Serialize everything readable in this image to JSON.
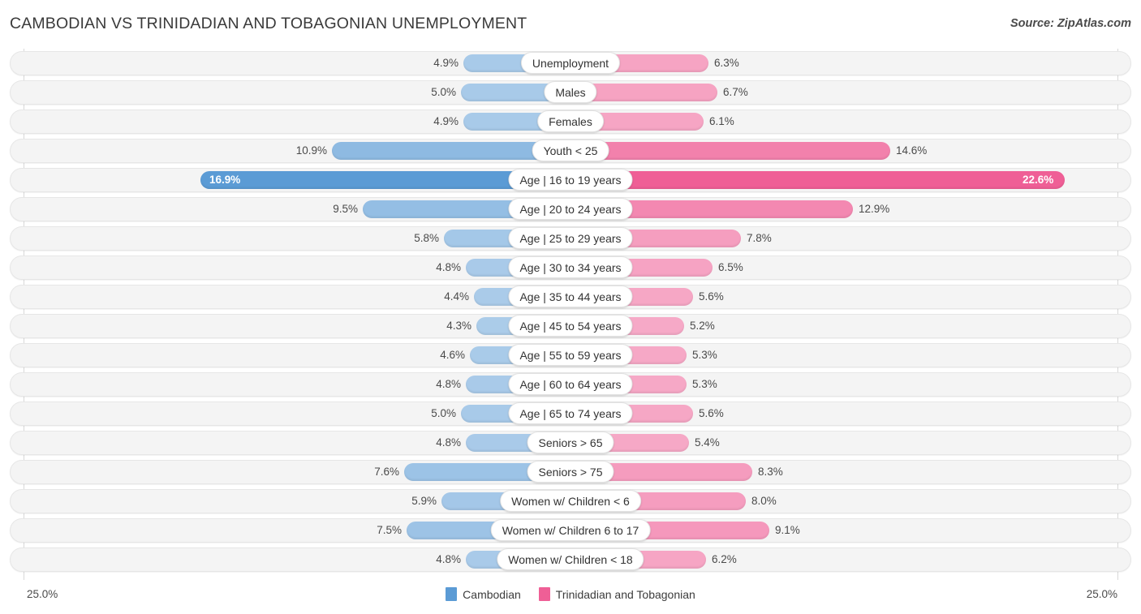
{
  "header": {
    "title": "CAMBODIAN VS TRINIDADIAN AND TOBAGONIAN UNEMPLOYMENT",
    "source": "Source: ZipAtlas.com"
  },
  "axis": {
    "left_label": "25.0%",
    "right_label": "25.0%",
    "max": 25.0
  },
  "legend": [
    {
      "label": "Cambodian",
      "color": "#5b9bd5"
    },
    {
      "label": "Trinidadian and Tobagonian",
      "color": "#ef5f96"
    }
  ],
  "colors": {
    "left_base": "#5b9bd5",
    "right_base": "#ef5f96",
    "left_light": "#9cc3ea",
    "right_light": "#f79ebc",
    "track": "#f4f4f4",
    "gridline": "#d8d8d8"
  },
  "chart_data": {
    "type": "bar",
    "title": "CAMBODIAN VS TRINIDADIAN AND TOBAGONIAN UNEMPLOYMENT",
    "subtitle": "",
    "orientation": "horizontal-diverging",
    "xlabel": "",
    "ylabel": "",
    "xlim": [
      25.0,
      25.0
    ],
    "grid": true,
    "legend_position": "bottom-center",
    "categories": [
      "Unemployment",
      "Males",
      "Females",
      "Youth < 25",
      "Age | 16 to 19 years",
      "Age | 20 to 24 years",
      "Age | 25 to 29 years",
      "Age | 30 to 34 years",
      "Age | 35 to 44 years",
      "Age | 45 to 54 years",
      "Age | 55 to 59 years",
      "Age | 60 to 64 years",
      "Age | 65 to 74 years",
      "Seniors > 65",
      "Seniors > 75",
      "Women w/ Children < 6",
      "Women w/ Children 6 to 17",
      "Women w/ Children < 18"
    ],
    "series": [
      {
        "name": "Cambodian",
        "color": "#5b9bd5",
        "values": [
          4.9,
          5.0,
          4.9,
          10.9,
          16.9,
          9.5,
          5.8,
          4.8,
          4.4,
          4.3,
          4.6,
          4.8,
          5.0,
          4.8,
          7.6,
          5.9,
          7.5,
          4.8
        ],
        "labels": [
          "4.9%",
          "5.0%",
          "4.9%",
          "10.9%",
          "16.9%",
          "9.5%",
          "5.8%",
          "4.8%",
          "4.4%",
          "4.3%",
          "4.6%",
          "4.8%",
          "5.0%",
          "4.8%",
          "7.6%",
          "5.9%",
          "7.5%",
          "4.8%"
        ]
      },
      {
        "name": "Trinidadian and Tobagonian",
        "color": "#ef5f96",
        "values": [
          6.3,
          6.7,
          6.1,
          14.6,
          22.6,
          12.9,
          7.8,
          6.5,
          5.6,
          5.2,
          5.3,
          5.3,
          5.6,
          5.4,
          8.3,
          8.0,
          9.1,
          6.2
        ],
        "labels": [
          "6.3%",
          "6.7%",
          "6.1%",
          "14.6%",
          "22.6%",
          "12.9%",
          "7.8%",
          "6.5%",
          "5.6%",
          "5.2%",
          "5.3%",
          "5.3%",
          "5.6%",
          "5.4%",
          "8.3%",
          "8.0%",
          "9.1%",
          "6.2%"
        ]
      }
    ],
    "highlighted_row": "Age | 16 to 19 years"
  }
}
